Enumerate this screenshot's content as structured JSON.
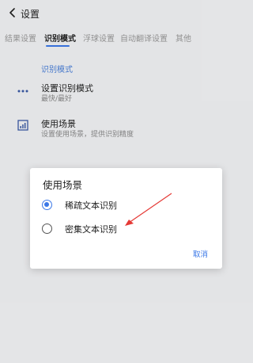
{
  "header": {
    "title": "设置"
  },
  "tabs": [
    {
      "label": "结果设置"
    },
    {
      "label": "识别模式"
    },
    {
      "label": "浮球设置"
    },
    {
      "label": "自动翻译设置"
    },
    {
      "label": "其他"
    }
  ],
  "section": {
    "header": "识别模式"
  },
  "settings": [
    {
      "title": "设置识别模式",
      "subtitle": "最快/最好",
      "icon": "more-dots-icon"
    },
    {
      "title": "使用场景",
      "subtitle": "设置使用场景，提供识别精度",
      "icon": "chart-icon"
    }
  ],
  "dialog": {
    "title": "使用场景",
    "options": [
      {
        "label": "稀疏文本识别",
        "selected": true
      },
      {
        "label": "密集文本识别",
        "selected": false
      }
    ],
    "cancel_label": "取消"
  },
  "colors": {
    "accent": "#3b78e7",
    "annotation_arrow": "#e53935"
  }
}
